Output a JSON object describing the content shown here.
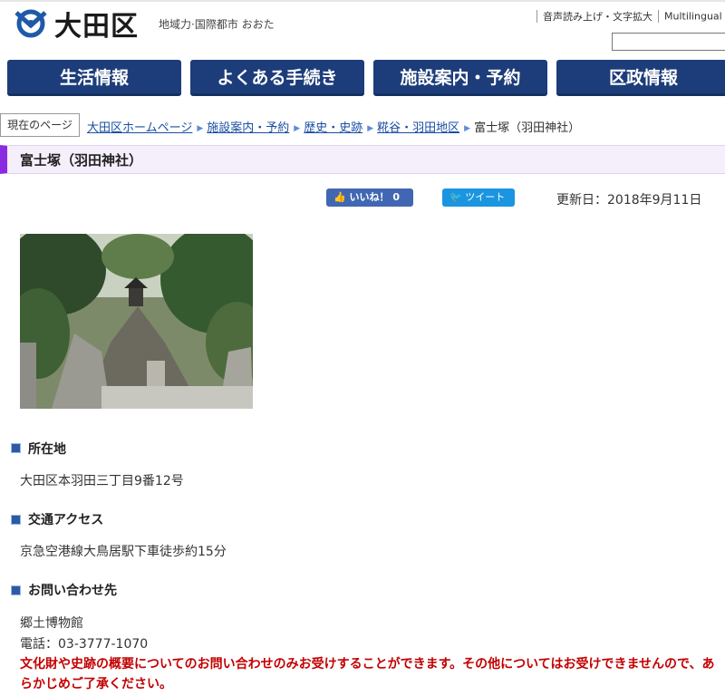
{
  "header": {
    "site_name": "大田区",
    "tagline": "地域力·国際都市 おおた",
    "util_links": [
      "音声読み上げ・文字拡大",
      "Multilingual"
    ],
    "search_placeholder": ""
  },
  "nav": {
    "items": [
      "生活情報",
      "よくある手続き",
      "施設案内・予約",
      "区政情報"
    ]
  },
  "breadcrumb": {
    "label": "現在のページ",
    "items": [
      "大田区ホームページ",
      "施設案内・予約",
      "歴史・史跡",
      "糀谷・羽田地区"
    ],
    "current": "富士塚（羽田神社）"
  },
  "page": {
    "title": "富士塚（羽田神社）",
    "like_label": "いいね！ 0",
    "tweet_label": "ツイート",
    "updated": "更新日：2018年9月11日"
  },
  "sections": [
    {
      "heading": "所在地",
      "lines": [
        "大田区本羽田三丁目9番12号"
      ]
    },
    {
      "heading": "交通アクセス",
      "lines": [
        "京急空港線大鳥居駅下車徒歩約15分"
      ]
    },
    {
      "heading": "お問い合わせ先",
      "lines": [
        "郷土博物館",
        "電話：03-3777-1070"
      ]
    }
  ],
  "notice": "文化財や史跡の概要についてのお問い合わせのみお受けすることができます。その他についてはお受けできませんので、あらかじめご了承ください。",
  "colors": {
    "nav_bg": "#1d3d7a",
    "title_accent": "#8a2be2",
    "link": "#1a4fa3",
    "notice": "#c40000"
  }
}
